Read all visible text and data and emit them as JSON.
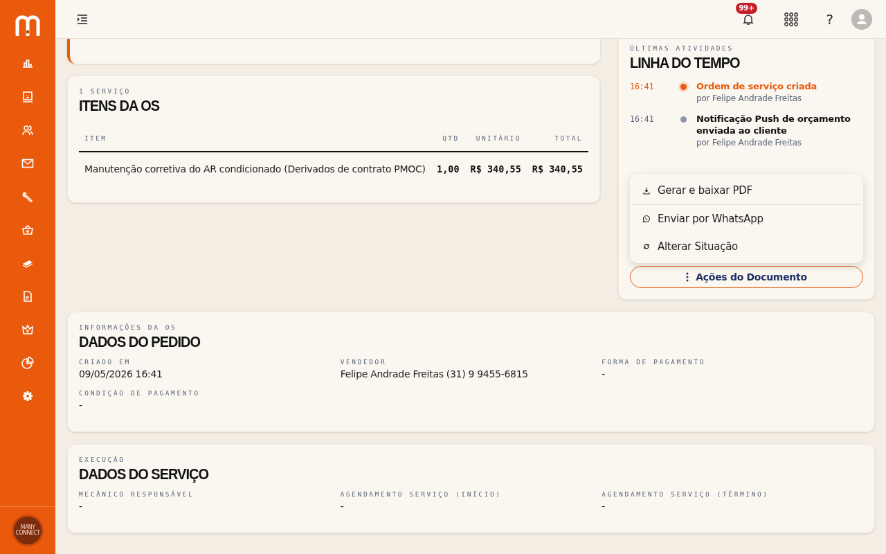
{
  "sidebar": {
    "nav_items": [
      {
        "kind": "chart"
      },
      {
        "kind": "monitor"
      },
      {
        "kind": "users"
      },
      {
        "kind": "mail"
      },
      {
        "kind": "wrench"
      },
      {
        "kind": "basket"
      },
      {
        "kind": "money"
      },
      {
        "kind": "document"
      },
      {
        "kind": "crown"
      },
      {
        "kind": "pie"
      },
      {
        "kind": "gear"
      }
    ],
    "account_logo": "MANY CONNECT"
  },
  "topbar": {
    "notification_badge": "99+",
    "help": "?"
  },
  "items_card": {
    "eyebrow": "1 SERVIÇO",
    "title": "ITENS DA OS",
    "columns": [
      "ITEM",
      "QTD",
      "UNITÁRIO",
      "TOTAL"
    ],
    "rows": [
      [
        "Manutenção corretiva do AR condicionado (Derivados de contrato PMOC)",
        "1,00",
        "R$ 340,55",
        "R$ 340,55"
      ]
    ]
  },
  "timeline_card": {
    "eyebrow": "ÚLTIMAS ATIVIDADES",
    "title": "LINHA DO TEMPO",
    "events": [
      {
        "time": "16:41",
        "title": "Ordem de serviço criada",
        "by": "por Felipe Andrade Freitas",
        "active": true
      },
      {
        "time": "16:41",
        "title": "Notificação Push de orçamento enviada ao cliente",
        "by": "por Felipe Andrade Freitas",
        "active": false
      }
    ],
    "menu": [
      {
        "kind": "download",
        "label": "Gerar e baixar PDF",
        "divider_after": true
      },
      {
        "kind": "whatsapp",
        "label": "Enviar por WhatsApp",
        "divider_after": false
      },
      {
        "kind": "refresh",
        "label": "Alterar Situação",
        "divider_after": false
      }
    ],
    "actions_button": "Ações do Documento"
  },
  "order_card": {
    "eyebrow": "INFORMAÇÕES DA OS",
    "title": "DADOS DO PEDIDO",
    "fields": [
      {
        "label": "CRIADO EM",
        "value": "09/05/2026 16:41"
      },
      {
        "label": "VENDEDOR",
        "value": "Felipe Andrade Freitas (31) 9 9455-6815"
      },
      {
        "label": "FORMA DE PAGAMENTO",
        "value": "-"
      },
      {
        "label": "CONDIÇÃO DE PAGAMENTO",
        "value": "-"
      }
    ]
  },
  "service_card": {
    "eyebrow": "EXECUÇÃO",
    "title": "DADOS DO SERVIÇO",
    "fields": [
      {
        "label": "MECÂNICO RESPONSÁVEL",
        "value": "-"
      },
      {
        "label": "AGENDAMENTO SERVIÇO (INÍCIO)",
        "value": "-"
      },
      {
        "label": "AGENDAMENTO SERVIÇO (TÉRMINO)",
        "value": "-"
      }
    ]
  }
}
